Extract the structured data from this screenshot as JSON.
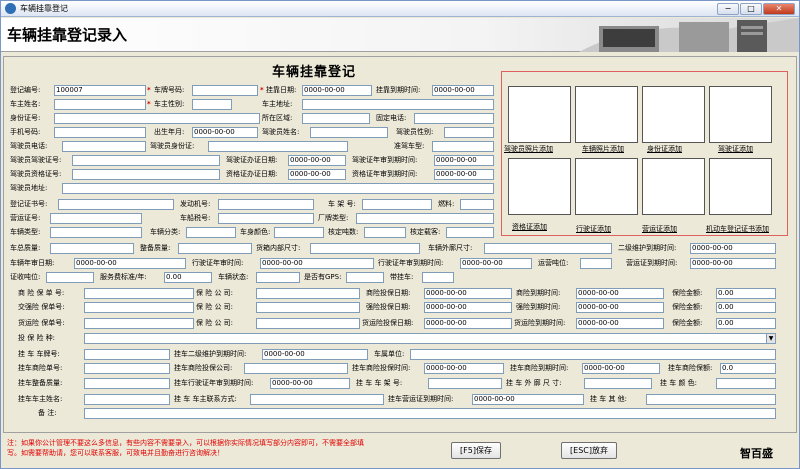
{
  "window": {
    "title": "车辆挂靠登记",
    "min": "−",
    "max": "□",
    "close": "✕"
  },
  "banner": {
    "title": "车辆挂靠登记录入"
  },
  "form": {
    "title": "车辆挂靠登记",
    "labels": {
      "reg_no": "登记编号:",
      "plate_no": "车牌号码:",
      "attach_date": "挂靠日期:",
      "attach_expire": "挂靠到期时间:",
      "owner_name": "车主姓名:",
      "owner_gender": "车主性别:",
      "owner_addr": "车主地址:",
      "id_card": "身份证号:",
      "region": "所在区域:",
      "phone": "固定电话:",
      "mobile": "手机号码:",
      "birth": "出生年月:",
      "driver_name": "驾驶员姓名:",
      "driver_gender": "驾驶员性别:",
      "driver_phone": "驾驶员电话:",
      "driver_id": "驾驶员身份证:",
      "license_type": "准驾车型:",
      "driver_license_no": "驾驶员驾驶证号:",
      "lic_issue_date": "驾驶证办证日期:",
      "lic_review_date": "驾驶证年审到期时间:",
      "qual_cert_no": "驾驶员资格证号:",
      "qual_issue_date": "资格证办证日期:",
      "qual_review_date": "资格证年审到期时间:",
      "driver_addr": "驾驶员地址:",
      "reg_cert_no": "登记证书号:",
      "engine_no": "发动机号:",
      "frame_no": "车 架 号:",
      "fuel": "燃料:",
      "op_cert_no": "营运证号:",
      "tax_no": "车船税号:",
      "factory_type": "厂牌类型:",
      "vehicle_type": "车辆类型:",
      "vehicle_class": "车辆分类:",
      "body_color": "车身颜色:",
      "seats": "核定吨数:",
      "capacity": "核定载客:",
      "gross_mass": "车总质量:",
      "curb_mass": "整备质量:",
      "cargo_size": "货箱内部尺寸:",
      "outer_size": "车辆外廓尺寸:",
      "l2_maint": "二级维护到期时间:",
      "review_date": "车辆年审日期:",
      "drv_review": "行驶证年审时间:",
      "drv_review_expire": "行驶证年审到期时间:",
      "op_unit": "运营吨位:",
      "op_cert_expire": "营运证到期时间:",
      "cert_pos": "证收吨位:",
      "fee": "服务费标准/年:",
      "veh_status": "车辆状态:",
      "gps": "是否有GPS:",
      "trailer": "带挂车:",
      "com_ins_no": "商 险 保 单 号:",
      "com_ins_co": "保 险 公 司:",
      "com_ins_date": "商险投保日期:",
      "com_ins_expire": "商险到期时间:",
      "com_ins_amt": "保险金额:",
      "cpl_ins_no": "交强险 保单号:",
      "cpl_ins_co": "保 险 公 司:",
      "cpl_ins_date": "强险投保日期:",
      "cpl_ins_expire": "强险到期时间:",
      "cpl_ins_amt": "保险金额:",
      "cargo_ins_no": "货运险 保单号:",
      "cargo_ins_co": "保 险 公 司:",
      "cargo_ins_date": "货运险投保日期:",
      "cargo_ins_expire": "货运险到期时间:",
      "cargo_ins_amt": "保险金额:",
      "ins_type": "投 保 险 种:",
      "tr_plate": "挂 车 车牌号:",
      "tr_l2": "挂车二级维护到期时间:",
      "tr_unit": "车属单位:",
      "tr_com_no": "挂车商险单号:",
      "tr_com_co": "挂车商险投保公司:",
      "tr_com_date": "挂车商险投保时间:",
      "tr_com_expire": "挂车商险到期时间:",
      "tr_com_fee": "挂车商险保额:",
      "tr_mass": "挂车整备质量:",
      "tr_drv_review": "挂车行驶证年审到期时间:",
      "tr_frame": "挂 车 车 架 号:",
      "tr_outer": "挂 车 外 廓 尺 寸:",
      "tr_color": "挂 车 颜 色:",
      "tr_owner": "挂车车主姓名:",
      "tr_contact": "挂 车 车主联系方式:",
      "tr_op_expire": "挂车营运证到期时间:",
      "tr_other": "挂 车 其 他:",
      "remark": "备 注:"
    },
    "values": {
      "reg_no": "100007",
      "date_placeholder": "0000-00-00",
      "money_zero": "0.00",
      "money_zero_short": "0.0"
    }
  },
  "photos": [
    {
      "label": "驾驶员照片添加"
    },
    {
      "label": "车辆照片添加"
    },
    {
      "label": "身份证添加"
    },
    {
      "label": "驾驶证添加"
    },
    {
      "label": "资格证添加"
    },
    {
      "label": "行驶证添加"
    },
    {
      "label": "营运证添加"
    },
    {
      "label": "机动车登记证书添加"
    }
  ],
  "footer": {
    "note": "注：如果你公计管理不要这么多信息，有些内容不需要录入，可以根据你实际情况填写部分内容即可，不需要全部填写。如需要帮助请，您可以联系客服，可致电并且勤奋进行咨询解决！",
    "save": "[F5]保存",
    "cancel": "[ESC]放弃",
    "brand": "智百盛"
  }
}
